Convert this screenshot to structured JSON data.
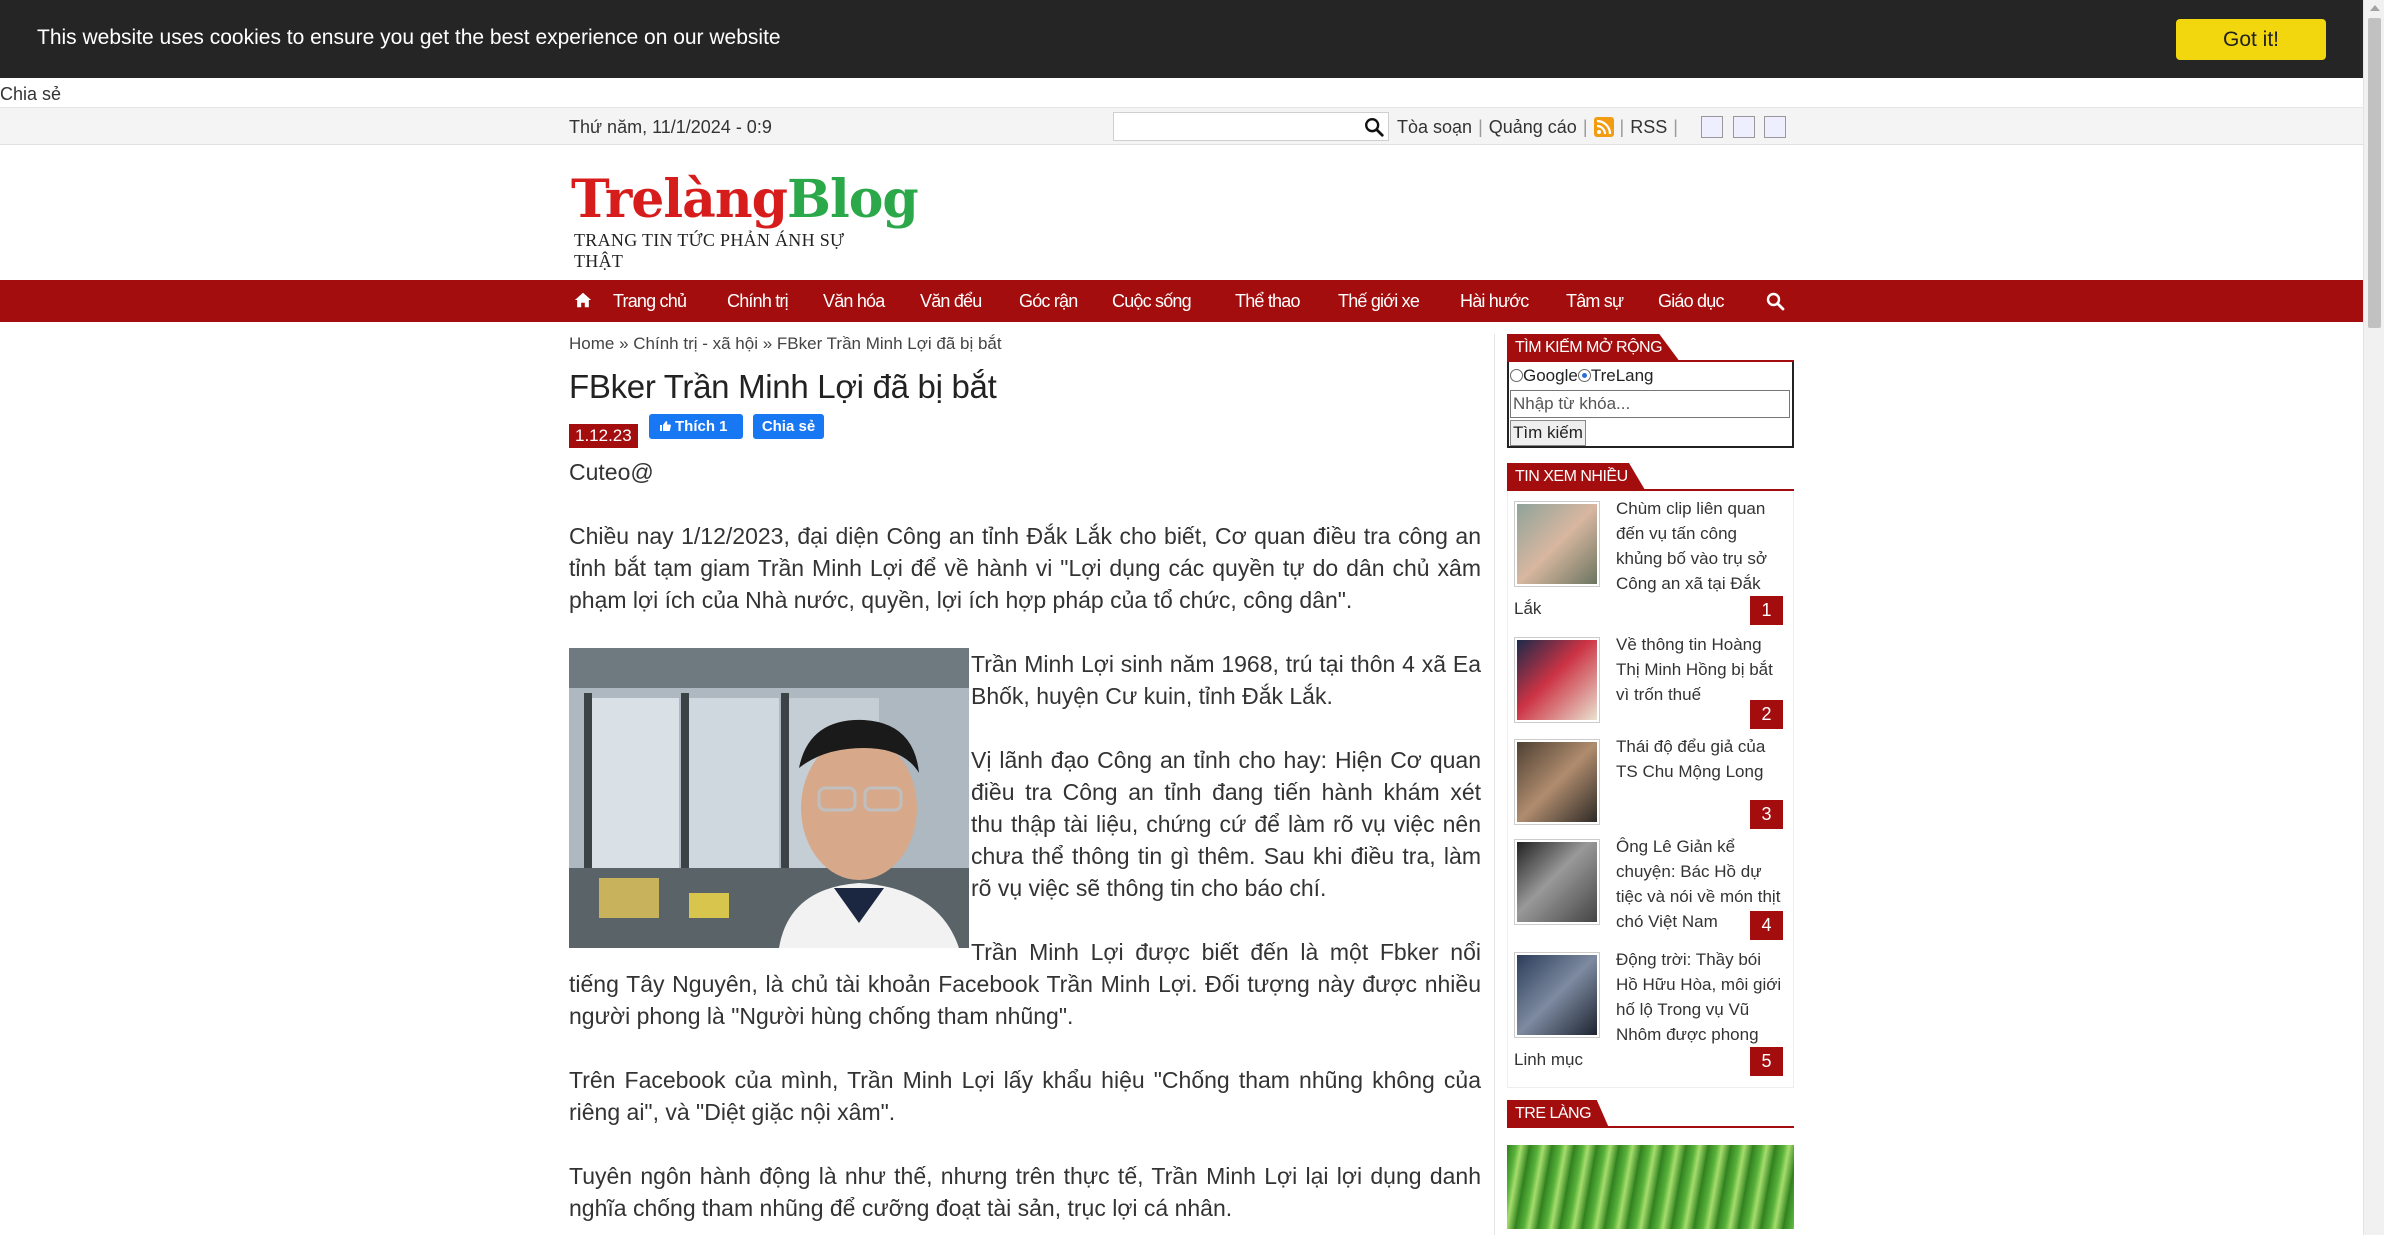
{
  "cookie": {
    "message": "This website uses cookies to ensure you get the best experience on our website",
    "button": "Got it!"
  },
  "share_label": "Chia sẻ",
  "topbar": {
    "date": "Thứ năm, 11/1/2024 - 0:9",
    "links": [
      "Tòa soạn",
      "Quảng cáo",
      "RSS"
    ],
    "search_icon": "search-icon",
    "rss_icon": "rss-icon"
  },
  "logo": {
    "part1": "Trelàng",
    "part2": "Blog",
    "tagline": "TRANG TIN TỨC PHẢN ÁNH SỰ THẬT"
  },
  "nav": {
    "home_icon": "home-icon",
    "items": [
      "Trang chủ",
      "Chính trị",
      "Văn hóa",
      "Văn đểu",
      "Góc rận",
      "Cuộc sống",
      "Thể thao",
      "Thế giới xe",
      "Hài hước",
      "Tâm sự",
      "Giáo dục"
    ],
    "search_icon": "search-icon"
  },
  "breadcrumb": {
    "home": "Home",
    "sep": " » ",
    "category": "Chính trị - xã hội",
    "current": "FBker Trần Minh Lợi đã bị bắt"
  },
  "article": {
    "title": "FBker Trần Minh Lợi đã bị bắt",
    "date": "1.12.23",
    "like_label": "Thích 1",
    "share_label": "Chia sẻ",
    "author": "Cuteo@",
    "paragraphs": [
      "Chiều nay 1/12/2023, đại diện Công an tỉnh Đắk Lắk cho biết, Cơ quan điều tra công an tỉnh bắt tạm giam Trần Minh Lợi để về hành vi \"Lợi dụng các quyền tự do dân chủ xâm phạm lợi ích của Nhà nước, quyền, lợi ích hợp pháp của tổ chức, công dân\".",
      "Trần Minh Lợi sinh năm 1968, trú tại thôn 4 xã Ea Bhốk, huyện Cư kuin, tỉnh Đắk Lắk.",
      "Vị lãnh đạo Công an tỉnh cho hay: Hiện Cơ quan điều tra Công an tỉnh đang tiến hành khám xét thu thập tài liệu, chứng cứ để làm rõ vụ việc nên chưa thể thông tin gì thêm. Sau khi điều tra, làm rõ vụ việc sẽ thông tin cho báo chí.",
      "Trần Minh Lợi được biết đến là một Fbker nổi tiếng Tây Nguyên, là chủ tài khoản Facebook Trần Minh Lợi. Đối tượng này được nhiều người phong là \"Người hùng chống tham nhũng\".",
      "Trên Facebook của mình, Trần Minh Lợi lấy khẩu hiệu \"Chống tham nhũng không của riêng ai\", và \"Diệt giặc nội xâm\".",
      "Tuyên ngôn hành động là như thế, nhưng trên thực tế, Trần Minh Lợi lại lợi dụng danh nghĩa chống tham nhũng để cưỡng đoạt tài sản, trục lợi cá nhân."
    ]
  },
  "sidebar": {
    "search": {
      "heading": "TÌM KIẾM MỞ RỘNG",
      "option_google": "Google",
      "option_trelang": "TreLang",
      "selected": "TreLang",
      "placeholder": "Nhập từ khóa...",
      "button": "Tìm kiếm"
    },
    "most_read": {
      "heading": "TIN XEM NHIỀU",
      "items": [
        {
          "title": "Chùm clip liên quan đến vụ tấn công khủng bố vào trụ sở Công an xã tại Đắk Lắk",
          "rank": "1"
        },
        {
          "title": "Về thông tin Hoàng Thị Minh Hồng bị bắt vì trốn thuế",
          "rank": "2"
        },
        {
          "title": "Thái độ đểu giả của TS Chu Mộng Long",
          "rank": "3"
        },
        {
          "title": "Ông Lê Giản kể chuyện: Bác Hồ dự tiệc và nói về món thịt chó Việt Nam",
          "rank": "4"
        },
        {
          "title": "Động trời: Thầy bói Hồ Hữu Hòa, môi giới hố lộ Trong vụ Vũ Nhôm được phong Linh mục",
          "rank": "5"
        }
      ]
    },
    "tre_lang": {
      "heading": "TRE LÀNG"
    }
  },
  "colors": {
    "brand_red": "#a30d0d",
    "cookie_button": "#f2d70f",
    "facebook_blue": "#1877f2",
    "logo_red": "#d71c1c",
    "logo_green": "#2aa84a"
  }
}
